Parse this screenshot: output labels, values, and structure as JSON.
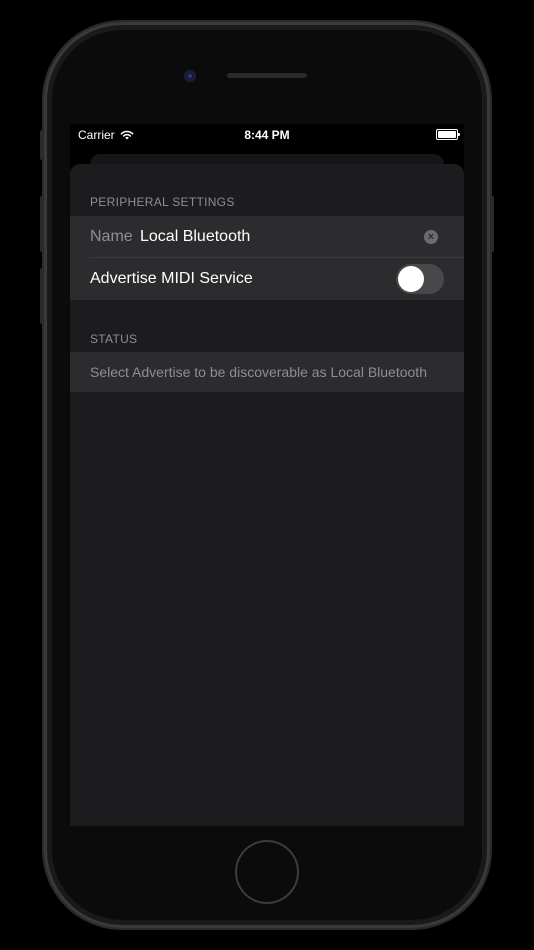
{
  "status_bar": {
    "carrier": "Carrier",
    "time": "8:44 PM"
  },
  "peripheral_settings": {
    "header": "PERIPHERAL SETTINGS",
    "name_label": "Name",
    "name_value": "Local Bluetooth",
    "advertise_label": "Advertise MIDI Service",
    "advertise_enabled": false
  },
  "status": {
    "header": "STATUS",
    "message": "Select Advertise to be discoverable as Local Bluetooth"
  },
  "icons": {
    "clear": "clear-icon",
    "wifi": "wifi-icon",
    "battery": "battery-icon"
  },
  "colors": {
    "background": "#1c1c1e",
    "cell": "#2c2c2e",
    "secondary_text": "#8e8e93",
    "toggle_off": "#48484a"
  }
}
